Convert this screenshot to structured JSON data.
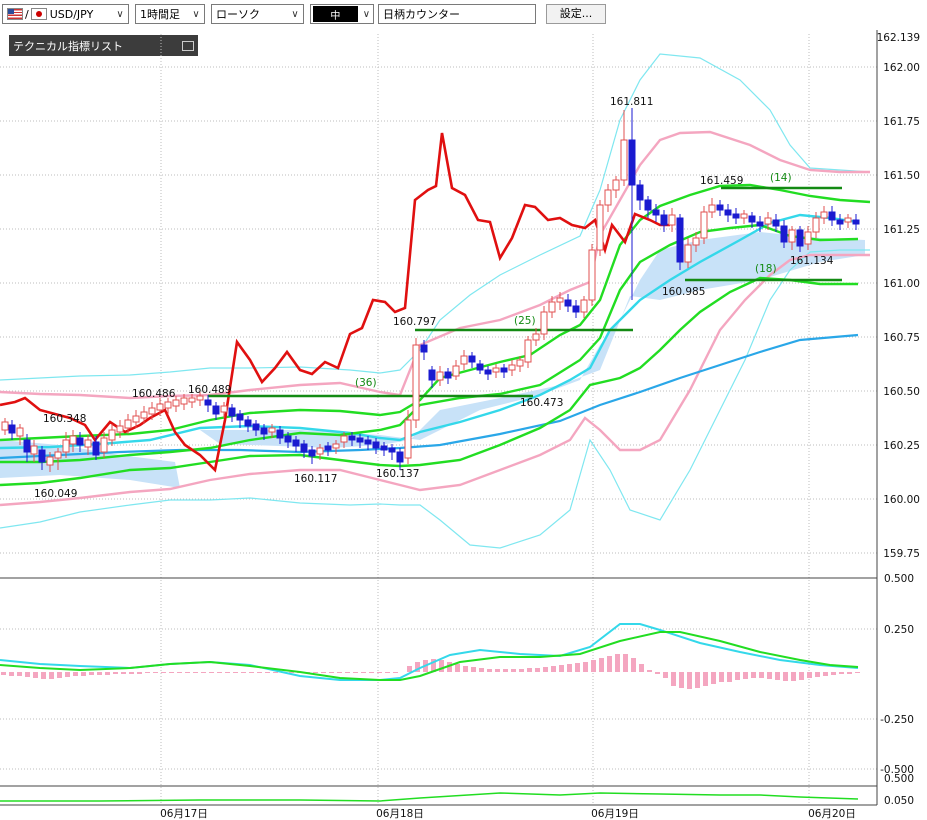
{
  "toolbar": {
    "symbol": "USD/JPY",
    "timeframe": "1時間足",
    "chart_type": "ローソク",
    "line_width": "中",
    "counter_label": "日柄カウンター",
    "settings_label": "設定..."
  },
  "indicator_panel": {
    "label": "テクニカル指標リスト"
  },
  "colors": {
    "up_candle": "#e05050",
    "down_candle": "#1a1ad0",
    "close_line": "#e01010",
    "bollinger": "#f4a6c0",
    "envelope": "#7fe7f0",
    "ma_green": "#22dd22",
    "ma_blue": "#2aa7e8",
    "cloud": "#c8e2f8",
    "horizontal_marker": "#138a13",
    "grid": "#bdbdbd"
  },
  "price_axis": {
    "labels": [
      "162.139",
      "162.00",
      "161.75",
      "161.50",
      "161.25",
      "161.00",
      "160.75",
      "160.50",
      "160.25",
      "160.00",
      "159.75"
    ]
  },
  "macd_axis": {
    "labels": [
      "0.500",
      "0.250",
      "-0.250",
      "-0.500"
    ]
  },
  "sub_axis": {
    "labels": [
      "0.500",
      "0.050"
    ]
  },
  "date_axis": {
    "labels": [
      "06月17日",
      "06月18日",
      "06月19日",
      "06月20日"
    ]
  },
  "annotations": {
    "high_160_486": "160.486",
    "high_160_489": "160.489",
    "level_160_348": "160.348",
    "low_160_049": "160.049",
    "low_160_117": "160.117",
    "low_160_137": "160.137",
    "high_160_797": "160.797",
    "low_160_473": "160.473",
    "high_161_811": "161.811",
    "high_161_459": "161.459",
    "low_160_985": "160.985",
    "low_161_134": "161.134",
    "count_36": "(36)",
    "count_25": "(25)",
    "count_14": "(14)",
    "count_18": "(18)"
  }
}
